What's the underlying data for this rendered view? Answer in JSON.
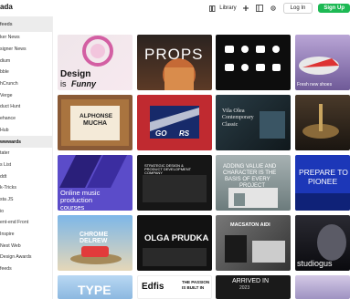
{
  "app": {
    "title": "ada"
  },
  "header": {
    "library_label": "Library",
    "login_label": "Log In",
    "signup_label": "Sign Up"
  },
  "sidebar": {
    "heading": "feeds",
    "items": [
      {
        "label": "ker News"
      },
      {
        "label": "signer News"
      },
      {
        "label": "dium"
      },
      {
        "label": "bble"
      },
      {
        "label": "hCrunch"
      },
      {
        "label": "Verge"
      },
      {
        "label": "duct Hunt"
      },
      {
        "label": "ehance"
      },
      {
        "label": "Hub"
      },
      {
        "label": "wwwards",
        "active": true
      },
      {
        "label": "tater"
      },
      {
        "label": "s List"
      },
      {
        "label": "ddt"
      },
      {
        "label": "k-Tricks"
      },
      {
        "label": "sta JS"
      },
      {
        "label": "io"
      },
      {
        "label": "ent-end Front"
      },
      {
        "label": "Inspire"
      },
      {
        "label": "Nest Web"
      },
      {
        "label": "Design Awards"
      },
      {
        "label": "feeds"
      }
    ]
  },
  "tiles": [
    {
      "texts": [
        "Design",
        "is",
        "Funny"
      ]
    },
    {
      "texts": [
        "PROPS"
      ]
    },
    {
      "texts": []
    },
    {
      "texts": [
        "Fresh new shoes"
      ]
    },
    {
      "texts": [
        "ALPHONSE",
        "MUCHA"
      ]
    },
    {
      "texts": [
        "GO",
        "RS"
      ]
    },
    {
      "texts": [
        "Vila Olea",
        "Contemporary",
        "Classic"
      ]
    },
    {
      "texts": []
    },
    {
      "texts": [
        "Online music",
        "production",
        "courses"
      ]
    },
    {
      "texts": [
        "STRATEGIC DESIGN &",
        "PRODUCT DEVELOPMENT",
        "COMPANY"
      ]
    },
    {
      "texts": [
        "ADDING VALUE AND",
        "CHARACTER IS THE",
        "BASIS OF EVERY",
        "PROJECT"
      ]
    },
    {
      "texts": [
        "PREPARE TO",
        "PIONEE"
      ]
    },
    {
      "texts": [
        "CHROME",
        "DELREW"
      ]
    },
    {
      "texts": [
        "OLGA PRUDKA"
      ]
    },
    {
      "texts": [
        "MACSATON AIDI"
      ]
    },
    {
      "texts": [
        "studiogus"
      ]
    },
    {
      "texts": [
        "TYPE"
      ]
    },
    {
      "texts": [
        "Edfis",
        "THE PASSION",
        "IS BUILT IN"
      ]
    },
    {
      "texts": [
        "ARRIVED IN",
        "2023"
      ]
    },
    {
      "texts": []
    }
  ],
  "colors": {
    "accent": "#1db954",
    "sidebar_active": "#ececec"
  }
}
